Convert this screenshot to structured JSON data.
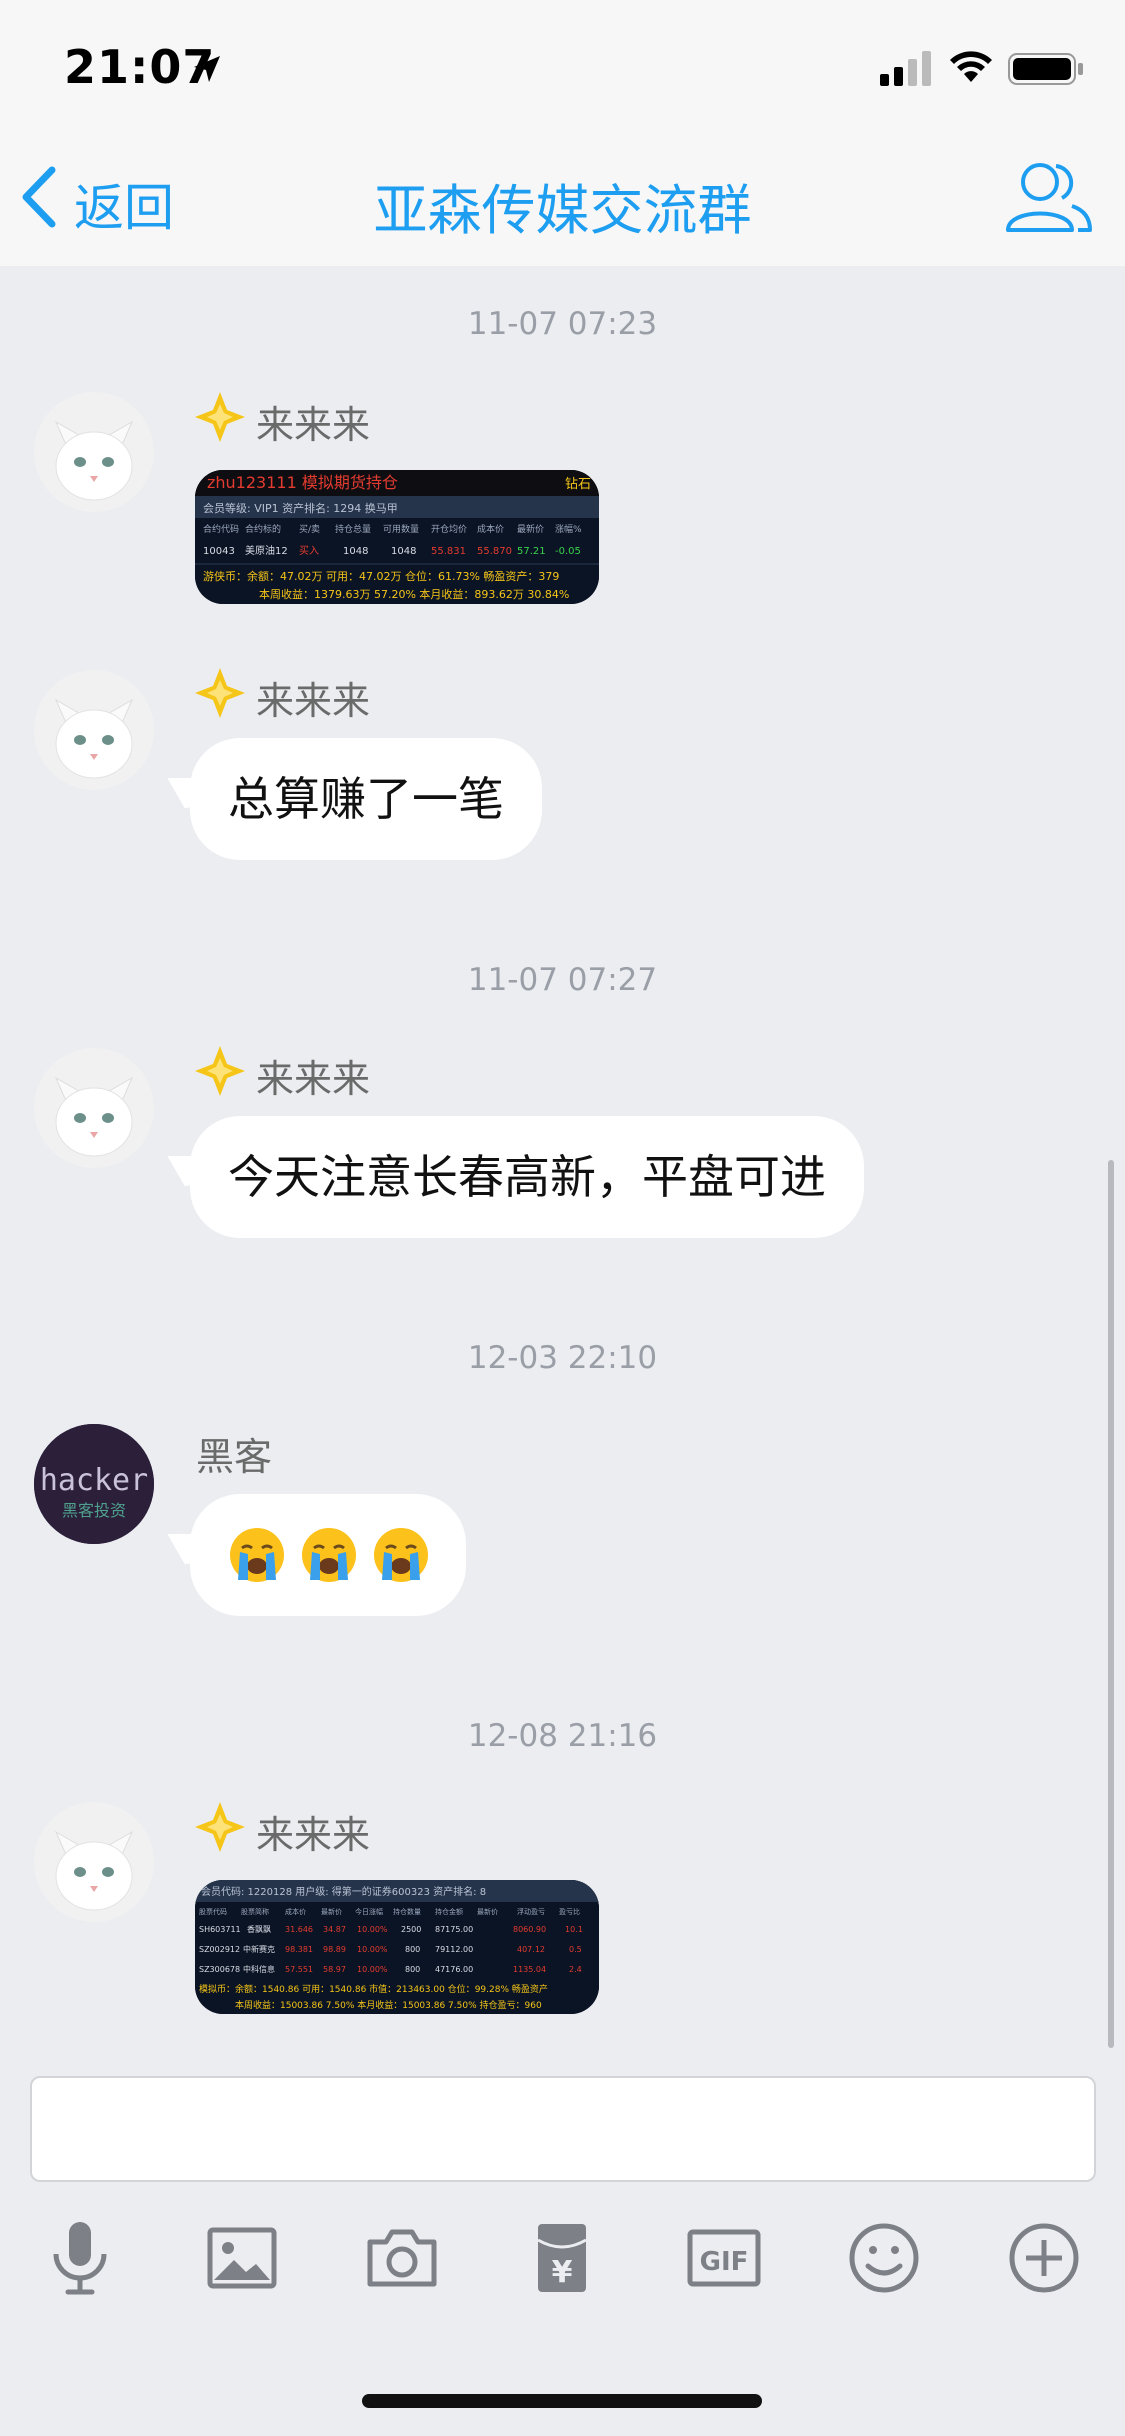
{
  "status_bar": {
    "time": "21:07"
  },
  "nav": {
    "back_label": "返回",
    "title": "亚森传媒交流群"
  },
  "messages": [
    {
      "timestamp": "11-07 07:23",
      "sender": "来来来",
      "type": "image",
      "image": {
        "header": "zhu123111 模拟期货持仓",
        "header_right": "钻石",
        "info": "会员等级: VIP1   资产排名: 1294   换马甲",
        "columns": [
          "合约代码",
          "合约标的",
          "买/卖",
          "持仓总量",
          "可用数量",
          "开仓均价",
          "成本价",
          "最新价",
          "涨幅%"
        ],
        "row": [
          "10043",
          "美原油12",
          "买入",
          "1048",
          "1048",
          "55.831",
          "55.870",
          "57.21",
          "-0.05"
        ],
        "summary1": "游侠币：余额：47.02万   可用：47.02万   仓位：61.73%   畅盈资产：379",
        "summary2": "本周收益：1379.63万  57.20%   本月收益：893.62万  30.84%"
      }
    },
    {
      "sender": "来来来",
      "type": "text",
      "text": "总算赚了一笔"
    },
    {
      "timestamp": "11-07 07:27",
      "sender": "来来来",
      "type": "text",
      "text": "今天注意长春高新，平盘可进"
    },
    {
      "timestamp": "12-03 22:10",
      "sender": "黑客",
      "type": "emoji",
      "avatar_text": "hacker",
      "avatar_subtext": "黑客投资",
      "emoji_name": "loudly-crying-face",
      "emoji_count": 3
    },
    {
      "timestamp": "12-08 21:16",
      "sender": "来来来",
      "type": "image",
      "image": {
        "header": "会员代码: 1220128   用户级: 得第一的证券600323   资产排名: 8",
        "columns": [
          "股票代码",
          "股票简称",
          "成本价",
          "最新价",
          "今日涨幅",
          "持仓数量",
          "持仓金额",
          "最新价",
          "浮动盈亏",
          "盈亏比"
        ],
        "rows": [
          [
            "SH603711",
            "香飘飘",
            "31.646",
            "34.87",
            "10.00%",
            "2500",
            "87175.00",
            "8060.90",
            "10.1"
          ],
          [
            "SZ002912",
            "中新赛克",
            "98.381",
            "98.89",
            "10.00%",
            "800",
            "79112.00",
            "407.12",
            "0.5"
          ],
          [
            "SZ300678",
            "中科信息",
            "57.551",
            "58.97",
            "10.00%",
            "800",
            "47176.00",
            "1135.04",
            "2.4"
          ]
        ],
        "summary1": "模拟币：余额：1540.86   可用：1540.86   市值：213463.00   仓位：99.28%   畅盈资产",
        "summary2": "本周收益：15003.86  7.50%   本月收益：15003.86  7.50%   持仓盈亏：960"
      }
    }
  ],
  "toolbar": [
    "microphone-icon",
    "image-icon",
    "camera-icon",
    "red-packet-icon",
    "gif-icon",
    "smiley-icon",
    "plus-icon"
  ],
  "colors": {
    "accent": "#1e9ef0",
    "background": "#ebedf1",
    "badge": "#f5c518"
  }
}
